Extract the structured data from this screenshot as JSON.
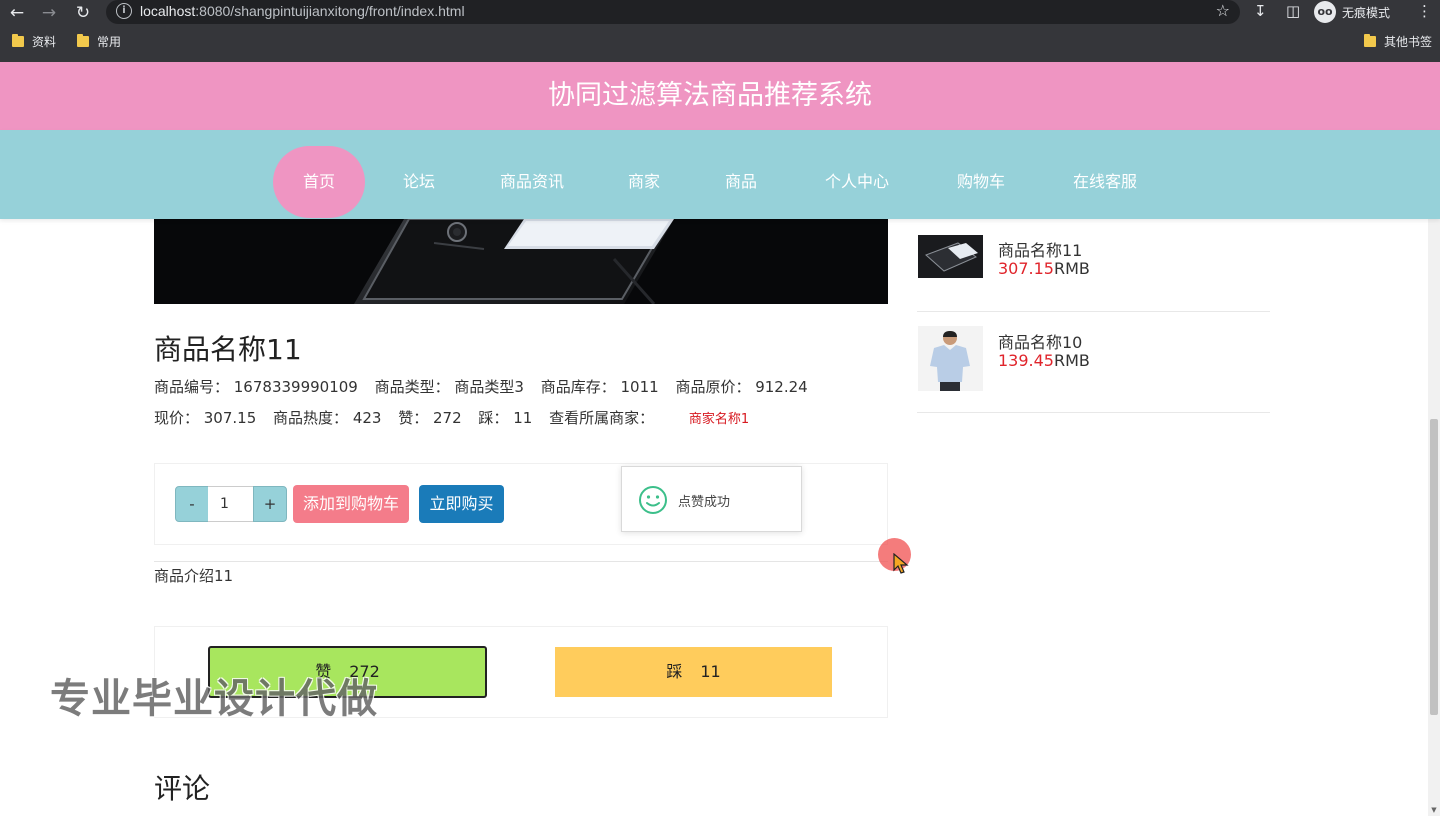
{
  "browser": {
    "url_host": "localhost",
    "url_rest": ":8080/shangpintuijianxitong/front/index.html",
    "incognito_label": "无痕模式",
    "bookmarks": [
      "资料",
      "常用"
    ],
    "other_bookmarks": "其他书签"
  },
  "site": {
    "title": "协同过滤算法商品推荐系统",
    "nav": [
      "首页",
      "论坛",
      "商品资讯",
      "商家",
      "商品",
      "个人中心",
      "购物车",
      "在线客服"
    ],
    "active_nav": "首页"
  },
  "product": {
    "name": "商品名称11",
    "line1": {
      "code": "商品编号：  1678339990109",
      "type": "商品类型：  商品类型3",
      "stock": "商品库存：  1011",
      "original_price": "商品原价：  912.24"
    },
    "line2": {
      "price": "现价：  307.15",
      "heat": "商品热度：  423",
      "likes": "赞：  272",
      "dislikes": "踩：  11",
      "merchant_label": "查看所属商家："
    },
    "merchant_link": "商家名称1",
    "quantity": "1",
    "qty_minus": "-",
    "qty_plus": "+",
    "add_to_cart": "添加到购物车",
    "buy_now": "立即购买",
    "description": "商品介绍11"
  },
  "toast": {
    "text": "点赞成功"
  },
  "vote": {
    "like_label": "赞",
    "like_count": "272",
    "dislike_label": "踩",
    "dislike_count": "11"
  },
  "watermark": "专业毕业设计代做",
  "comments_title": "评论",
  "sidebar": {
    "items": [
      {
        "name": "商品名称11",
        "price": "307.15",
        "unit": "RMB"
      },
      {
        "name": "商品名称10",
        "price": "139.45",
        "unit": "RMB"
      }
    ]
  },
  "colors": {
    "header_pink": "#ef95c2",
    "nav_cyan": "#96d1d9",
    "cart_button": "#f47c8a",
    "buy_button": "#1a7bb9",
    "like_button": "#a8e65e",
    "dislike_button": "#ffcc5c",
    "price_red": "#e0242b"
  }
}
